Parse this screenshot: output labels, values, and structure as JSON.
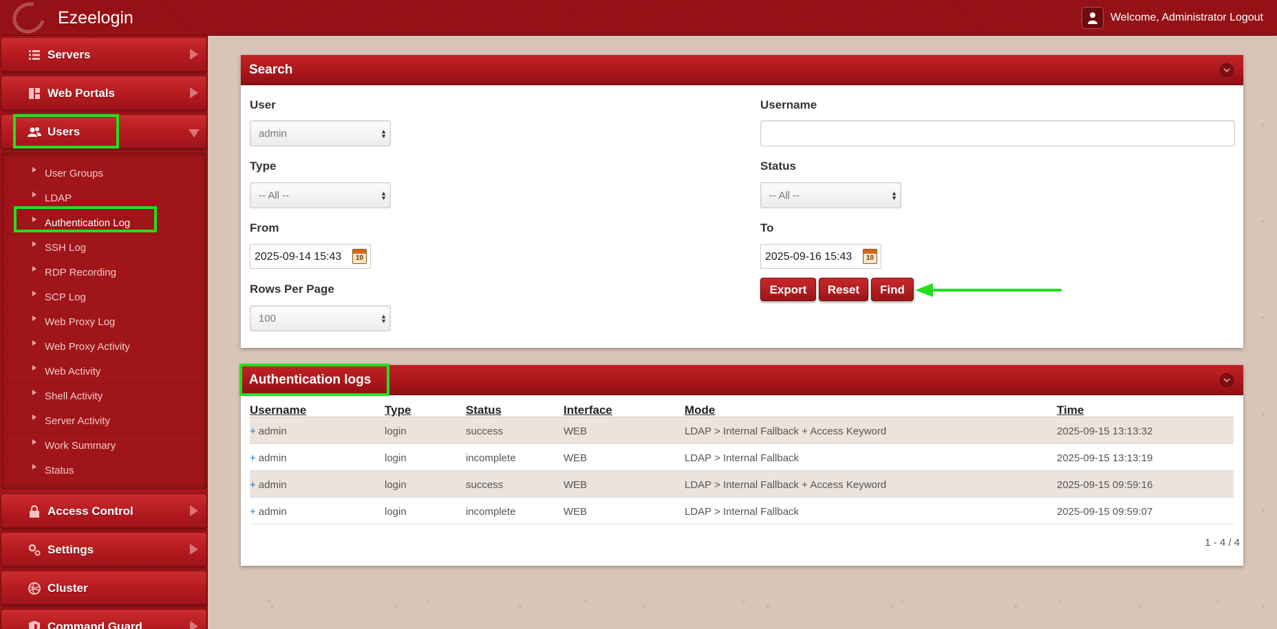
{
  "app": {
    "brand": "Ezeelogin",
    "welcome_text": "Welcome, Administrator",
    "logout_label": "Logout"
  },
  "sidebar": {
    "items_top": [
      {
        "label": "Servers",
        "icon": "list-icon"
      },
      {
        "label": "Web Portals",
        "icon": "dashboard-icon"
      },
      {
        "label": "Users",
        "icon": "users-icon"
      }
    ],
    "submenu": [
      "User Groups",
      "LDAP",
      "Authentication Log",
      "SSH Log",
      "RDP Recording",
      "SCP Log",
      "Web Proxy Log",
      "Web Proxy Activity",
      "Web Activity",
      "Shell Activity",
      "Server Activity",
      "Work Summary",
      "Status"
    ],
    "active_sub": "Authentication Log",
    "items_bottom": [
      {
        "label": "Access Control",
        "icon": "lock-icon"
      },
      {
        "label": "Settings",
        "icon": "gears-icon"
      },
      {
        "label": "Cluster",
        "icon": "globe-icon"
      },
      {
        "label": "Command Guard",
        "icon": "shield-icon"
      }
    ]
  },
  "search": {
    "title": "Search",
    "user_label": "User",
    "user_value": "admin",
    "username_label": "Username",
    "username_value": "",
    "type_label": "Type",
    "type_value": "-- All --",
    "status_label": "Status",
    "status_value": "-- All --",
    "from_label": "From",
    "from_value": "2025-09-14 15:43",
    "to_label": "To",
    "to_value": "2025-09-16 15:43",
    "rows_label": "Rows Per Page",
    "rows_value": "100",
    "calendar_day": "10",
    "buttons": {
      "export": "Export",
      "reset": "Reset",
      "find": "Find"
    }
  },
  "logs": {
    "title": "Authentication logs",
    "columns": [
      "Username",
      "Type",
      "Status",
      "Interface",
      "Mode",
      "Time"
    ],
    "rows": [
      {
        "username": "admin",
        "type": "login",
        "status": "success",
        "interface": "WEB",
        "mode": "LDAP > Internal Fallback + Access Keyword",
        "time": "2025-09-15 13:13:32"
      },
      {
        "username": "admin",
        "type": "login",
        "status": "incomplete",
        "interface": "WEB",
        "mode": "LDAP > Internal Fallback",
        "time": "2025-09-15 13:13:19"
      },
      {
        "username": "admin",
        "type": "login",
        "status": "success",
        "interface": "WEB",
        "mode": "LDAP > Internal Fallback + Access Keyword",
        "time": "2025-09-15 09:59:16"
      },
      {
        "username": "admin",
        "type": "login",
        "status": "incomplete",
        "interface": "WEB",
        "mode": "LDAP > Internal Fallback",
        "time": "2025-09-15 09:59:07"
      }
    ],
    "row_prefix": "+",
    "pagination": "1 - 4 / 4"
  },
  "colors": {
    "brand_red": "#a8161b",
    "highlight_green": "#22e01e",
    "link_blue": "#1f6fbf"
  }
}
